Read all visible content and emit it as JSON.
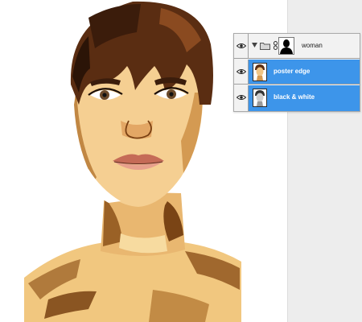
{
  "layers_panel": {
    "group": {
      "name": "woman",
      "expanded": true,
      "visible": true,
      "icon": "folder-icon"
    },
    "layers": [
      {
        "name": "poster edge",
        "visible": true,
        "selected": true
      },
      {
        "name": "black & white",
        "visible": true,
        "selected": true
      }
    ]
  },
  "colors": {
    "selection": "#3d95ea",
    "panel_background": "#f2f2f2",
    "side_panel": "#ededed"
  },
  "canvas": {
    "subject": "posterized portrait of a woman with short dark bangs"
  }
}
